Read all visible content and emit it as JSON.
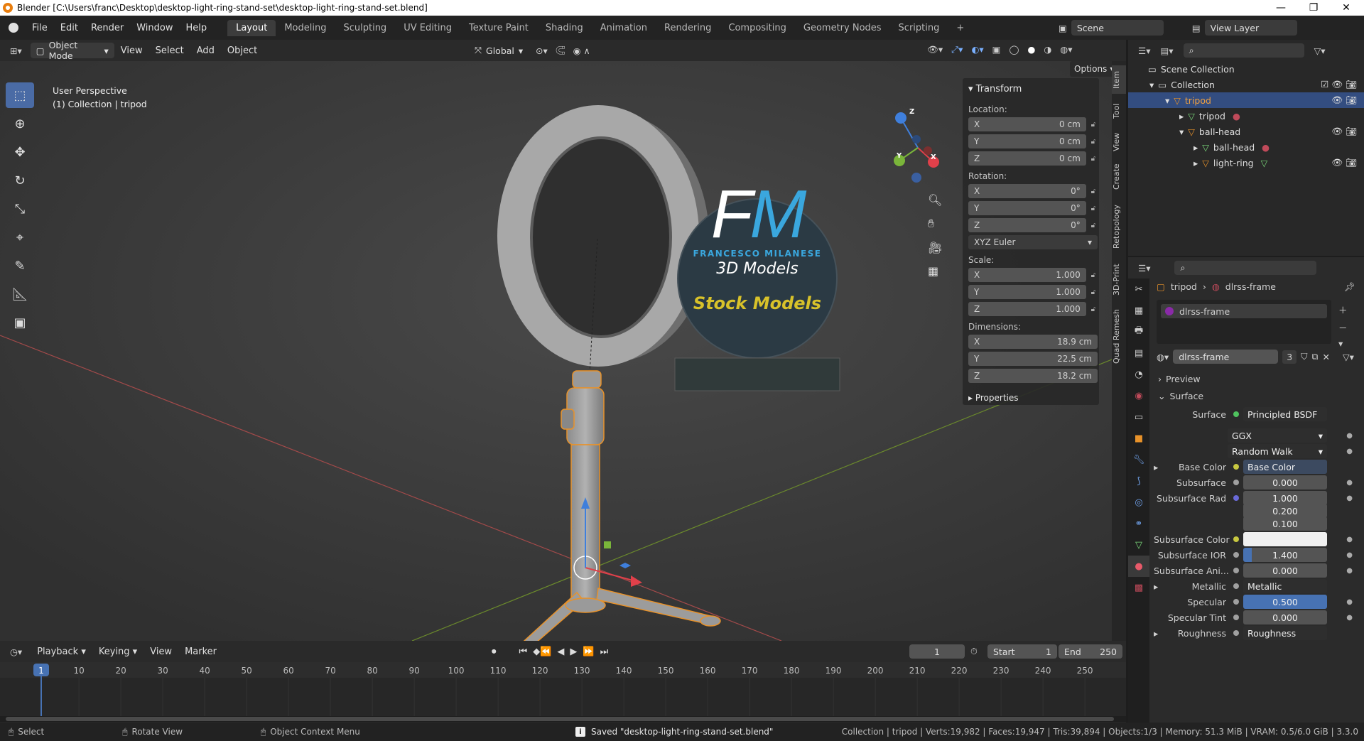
{
  "window": {
    "title": "Blender [C:\\Users\\franc\\Desktop\\desktop-light-ring-stand-set\\desktop-light-ring-stand-set.blend]",
    "min": "—",
    "max": "❐",
    "close": "✕"
  },
  "menu": [
    "File",
    "Edit",
    "Render",
    "Window",
    "Help"
  ],
  "workspaces": [
    "Layout",
    "Modeling",
    "Sculpting",
    "UV Editing",
    "Texture Paint",
    "Shading",
    "Animation",
    "Rendering",
    "Compositing",
    "Geometry Nodes",
    "Scripting",
    "+"
  ],
  "scene": {
    "scene_name": "Scene",
    "view_layer": "View Layer"
  },
  "viewport": {
    "mode": "Object Mode",
    "menus": [
      "View",
      "Select",
      "Add",
      "Object"
    ],
    "transform_orientation": "Global",
    "options": "Options",
    "overlay_text": {
      "line1": "User Perspective",
      "line2": "(1) Collection | tripod"
    },
    "watermark": {
      "brand": "FM",
      "name": "FRANCESCO MILANESE",
      "tagline": "3D Models",
      "stock": "Stock Models"
    },
    "gizmo": {
      "x": "X",
      "y": "Y",
      "z": "Z"
    }
  },
  "npanel": {
    "header": "Transform",
    "location_label": "Location:",
    "location": [
      {
        "axis": "X",
        "value": "0 cm"
      },
      {
        "axis": "Y",
        "value": "0 cm"
      },
      {
        "axis": "Z",
        "value": "0 cm"
      }
    ],
    "rotation_label": "Rotation:",
    "rotation": [
      {
        "axis": "X",
        "value": "0°"
      },
      {
        "axis": "Y",
        "value": "0°"
      },
      {
        "axis": "Z",
        "value": "0°"
      }
    ],
    "rotation_mode": "XYZ Euler",
    "scale_label": "Scale:",
    "scale": [
      {
        "axis": "X",
        "value": "1.000"
      },
      {
        "axis": "Y",
        "value": "1.000"
      },
      {
        "axis": "Z",
        "value": "1.000"
      }
    ],
    "dimensions_label": "Dimensions:",
    "dimensions": [
      {
        "axis": "X",
        "value": "18.9 cm"
      },
      {
        "axis": "Y",
        "value": "22.5 cm"
      },
      {
        "axis": "Z",
        "value": "18.2 cm"
      }
    ],
    "properties": "Properties",
    "tabs": [
      "Item",
      "Tool",
      "View",
      "Create",
      "Retopology",
      "3D-Print",
      "Quad Remesh"
    ]
  },
  "outliner": {
    "rows": [
      {
        "label": "Scene Collection",
        "indent": 0
      },
      {
        "label": "Collection",
        "indent": 1
      },
      {
        "label": "tripod",
        "indent": 2
      },
      {
        "label": "tripod",
        "indent": 3
      },
      {
        "label": "ball-head",
        "indent": 2
      },
      {
        "label": "ball-head",
        "indent": 3
      },
      {
        "label": "light-ring",
        "indent": 3
      }
    ]
  },
  "properties": {
    "breadcrumb_object": "tripod",
    "breadcrumb_material": "dlrss-frame",
    "slot_name": "dlrss-frame",
    "material_name": "dlrss-frame",
    "user_count": "3",
    "preview": "Preview",
    "surface_section": "Surface",
    "surface_label": "Surface",
    "surface_value": "Principled BSDF",
    "distribution": "GGX",
    "subsurface_method": "Random Walk",
    "rows": [
      {
        "label": "Base Color",
        "value": "Base Color"
      },
      {
        "label": "Subsurface",
        "value": "0.000"
      },
      {
        "label": "Subsurface Rad",
        "value": "1.000"
      },
      {
        "label": "",
        "value": "0.200"
      },
      {
        "label": "",
        "value": "0.100"
      },
      {
        "label": "Subsurface Color",
        "value": ""
      },
      {
        "label": "Subsurface IOR",
        "value": "1.400"
      },
      {
        "label": "Subsurface Ani...",
        "value": "0.000"
      },
      {
        "label": "Metallic",
        "value": "Metallic"
      },
      {
        "label": "Specular",
        "value": "0.500"
      },
      {
        "label": "Specular Tint",
        "value": "0.000"
      },
      {
        "label": "Roughness",
        "value": "Roughness"
      }
    ]
  },
  "timeline": {
    "menus": [
      "Playback",
      "Keying",
      "View",
      "Marker"
    ],
    "current_frame": "1",
    "start_label": "Start",
    "start": "1",
    "end_label": "End",
    "end": "250",
    "ticks": [
      "1",
      "10",
      "20",
      "30",
      "40",
      "50",
      "60",
      "70",
      "80",
      "90",
      "100",
      "110",
      "120",
      "130",
      "140",
      "150",
      "160",
      "170",
      "180",
      "190",
      "200",
      "210",
      "220",
      "230",
      "240",
      "250"
    ]
  },
  "status": {
    "select": "Select",
    "rotate": "Rotate View",
    "context": "Object Context Menu",
    "message": "Saved \"desktop-light-ring-stand-set.blend\"",
    "stats": "Collection | tripod | Verts:19,982 | Faces:19,947 | Tris:39,894 | Objects:1/3 | Memory: 51.3 MiB | VRAM: 0.5/6.0 GiB | 3.3.0"
  },
  "colors": {
    "accent": "#4772b3",
    "selection": "#e8922a",
    "watermark_blue": "#3aa7de",
    "watermark_gold": "#d8c22a"
  }
}
